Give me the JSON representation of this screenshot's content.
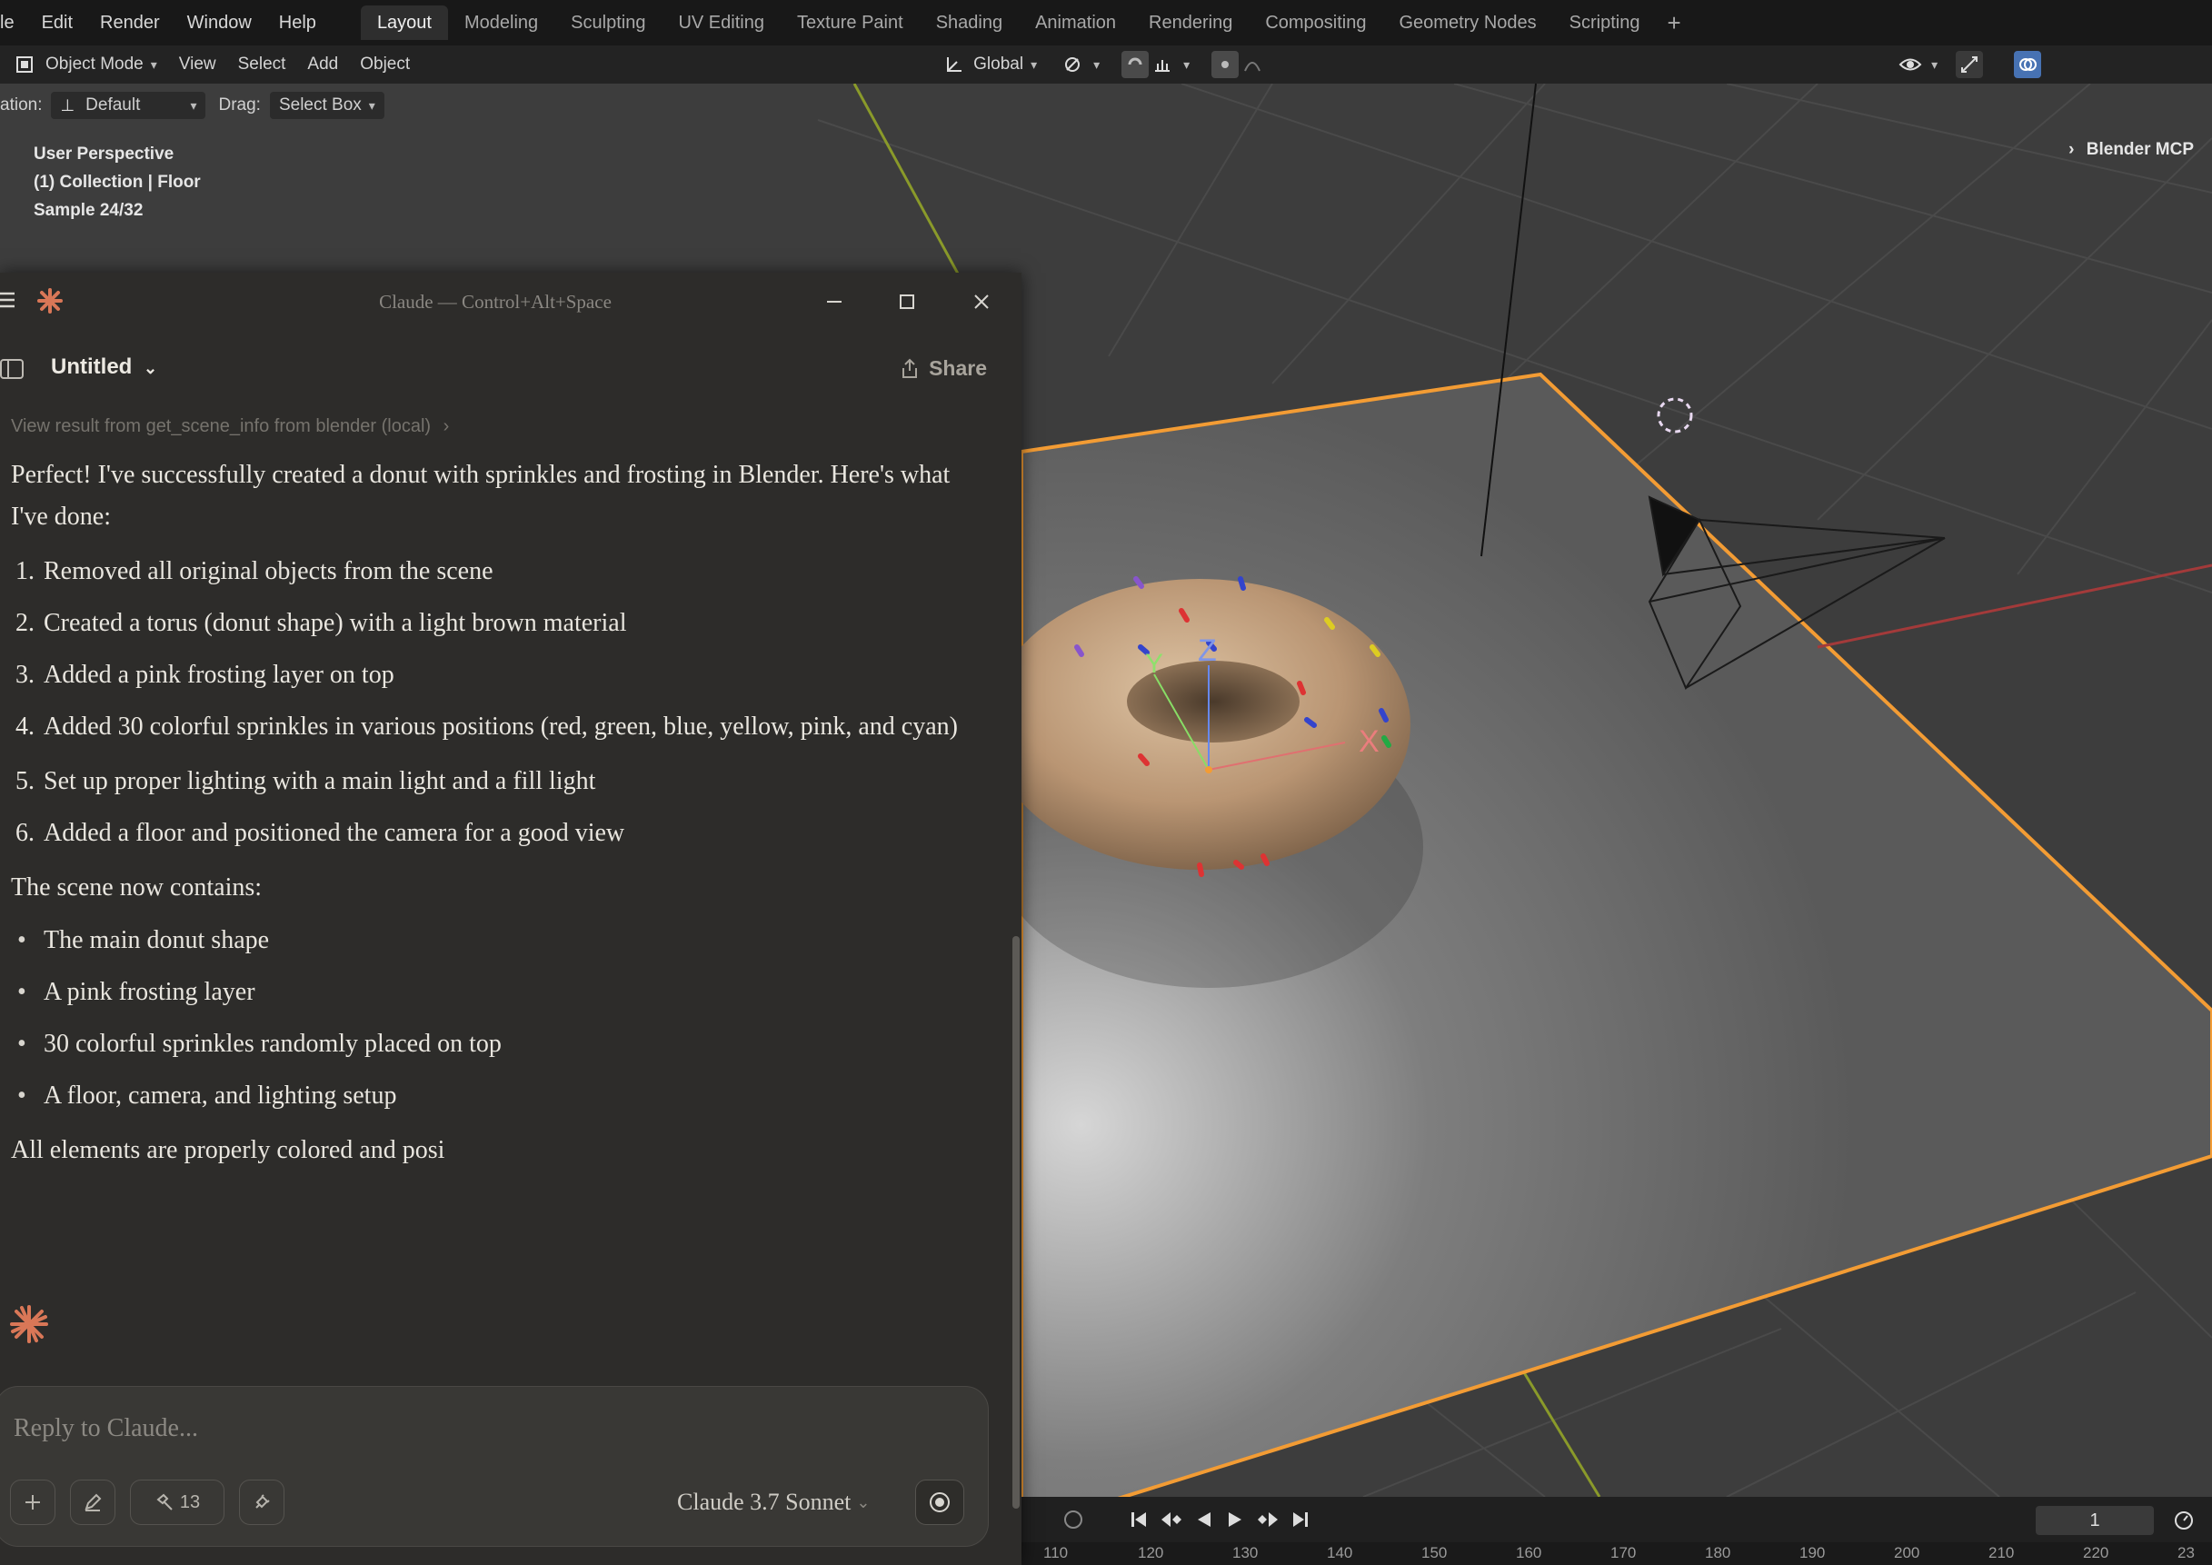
{
  "menubar": {
    "items": [
      "le",
      "Edit",
      "Render",
      "Window",
      "Help"
    ],
    "workspaces": [
      "Layout",
      "Modeling",
      "Sculpting",
      "UV Editing",
      "Texture Paint",
      "Shading",
      "Animation",
      "Rendering",
      "Compositing",
      "Geometry Nodes",
      "Scripting"
    ],
    "active_workspace": "Layout",
    "add_label": "+"
  },
  "header": {
    "mode": "Object Mode",
    "menus": [
      "View",
      "Select",
      "Add",
      "Object"
    ],
    "orientation": "Global"
  },
  "toolsettings": {
    "orientation_prefix": "ation:",
    "orientation_value": "Default",
    "drag_label": "Drag:",
    "drag_value": "Select Box"
  },
  "viewport": {
    "info_line1": "User Perspective",
    "info_line2": "(1) Collection | Floor",
    "info_line3": "Sample 24/32",
    "right_label": "Blender MCP",
    "axis_x": "X",
    "axis_y": "Y",
    "axis_z": "Z"
  },
  "claude": {
    "window_title": "Claude — Control+Alt+Space",
    "conversation_title": "Untitled",
    "share_label": "Share",
    "tool_result": "View result from get_scene_info from blender (local)",
    "intro": "Perfect! I've successfully created a donut with sprinkles and frosting in Blender. Here's what I've done:",
    "steps": [
      "Removed all original objects from the scene",
      "Created a torus (donut shape) with a light brown material",
      "Added a pink frosting layer on top",
      "Added 30 colorful sprinkles in various positions (red, green, blue, yellow, pink, and cyan)",
      "Set up proper lighting with a main light and a fill light",
      "Added a floor and positioned the camera for a good view"
    ],
    "contains_heading": "The scene now contains:",
    "contents": [
      "The main donut shape",
      "A pink frosting layer",
      "30 colorful sprinkles randomly placed on top",
      "A floor, camera, and lighting setup"
    ],
    "trailing": "All elements are properly colored and posi",
    "composer": {
      "placeholder": "Reply to Claude...",
      "tools_count": "13",
      "model": "Claude 3.7 Sonnet"
    }
  },
  "timeline": {
    "current_frame": "1",
    "ticks": [
      "110",
      "120",
      "130",
      "140",
      "150",
      "160",
      "170",
      "180",
      "190",
      "200",
      "210",
      "220",
      "23"
    ]
  },
  "colors": {
    "accent_blender_active": "#4772b3",
    "selection_outline": "#f39c34",
    "claude_orange": "#d97757",
    "claude_bg": "#2d2c2a"
  }
}
